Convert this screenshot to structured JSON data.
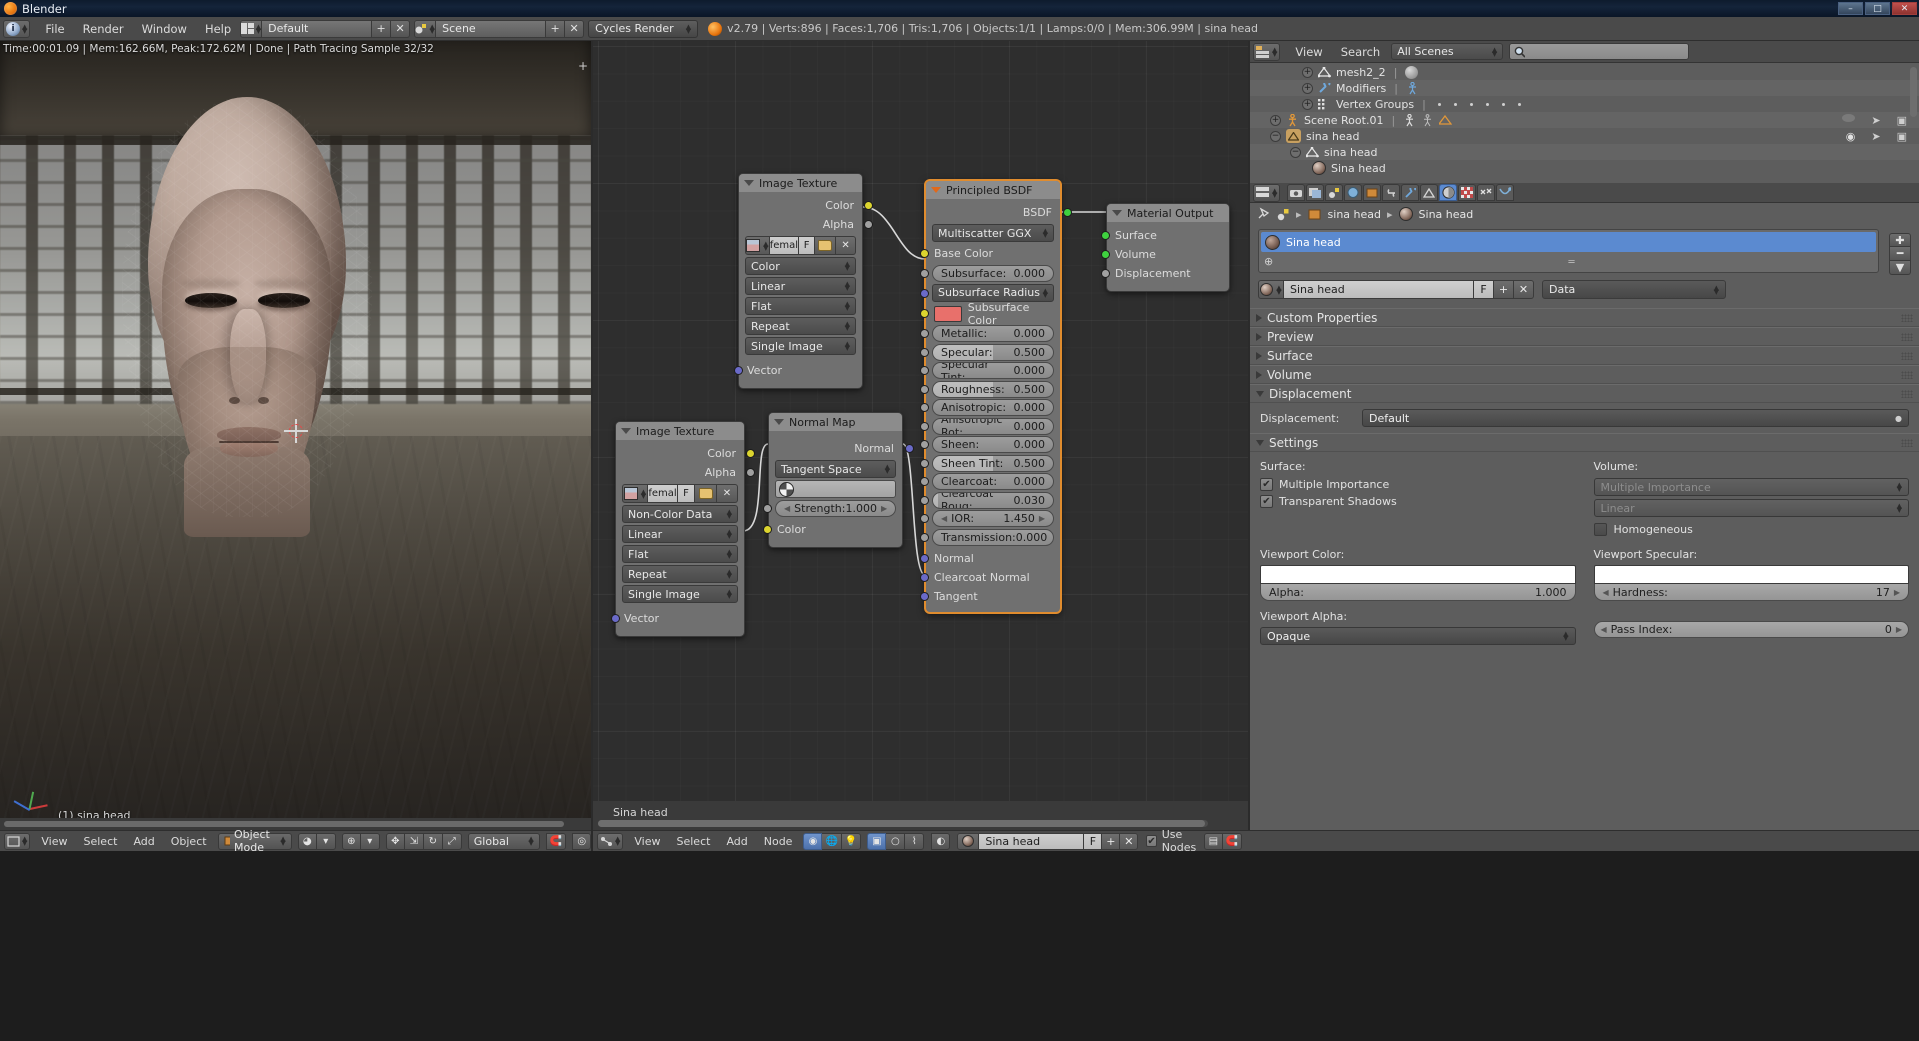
{
  "window": {
    "title": "Blender",
    "buttons": [
      "–",
      "□",
      "✕"
    ]
  },
  "header": {
    "screen_layout": "Default",
    "scene": "Scene",
    "engine": "Cycles Render",
    "menus": [
      "File",
      "Render",
      "Window",
      "Help"
    ],
    "stats": "v2.79 | Verts:896 | Faces:1,706 | Tris:1,706 | Objects:1/1 | Lamps:0/0 | Mem:306.99M | sina head",
    "add_icon": "+",
    "remove_icon": "✕"
  },
  "viewport": {
    "render_stats": "Time:00:01.09 | Mem:162.66M, Peak:172.62M | Done | Path Tracing Sample 32/32",
    "object_label": "(1) sina head",
    "bottom": {
      "menus": [
        "View",
        "Select",
        "Add",
        "Object"
      ],
      "mode": "Object Mode",
      "orientation": "Global",
      "pivot_icon": "pivot-icon",
      "snap_icon": "magnet-icon",
      "proportional_icon": "proportional-edit-icon",
      "layers_icon": "layers-icon"
    }
  },
  "node_editor": {
    "breadcrumb": "Sina head",
    "bottom": {
      "menus": [
        "View",
        "Select",
        "Add",
        "Node"
      ],
      "shader_type_icons": [
        "world-icon",
        "object-icon",
        "lamp-icon"
      ],
      "material_name": "Sina head",
      "fake_user": "F",
      "add_icon": "+",
      "remove_icon": "✕",
      "use_nodes_label": "Use Nodes",
      "use_nodes_checked": true
    },
    "nodes": [
      {
        "id": "image_texture_1",
        "title": "Image Texture",
        "outputs": [
          "Color",
          "Alpha"
        ],
        "image_name": "femal",
        "fake_user": "F",
        "dropdowns": [
          "Color",
          "Linear",
          "Flat",
          "Repeat",
          "Single Image"
        ],
        "inputs": [
          "Vector"
        ]
      },
      {
        "id": "principled_bsdf",
        "title": "Principled BSDF",
        "selected": true,
        "outputs": [
          "BSDF"
        ],
        "distribution": "Multiscatter GGX",
        "inputs": [
          {
            "label": "Base Color",
            "type": "socket",
            "socket": "yellow"
          },
          {
            "label": "Subsurface:",
            "value": "0.000",
            "type": "slider",
            "fill": 0.0
          },
          {
            "label": "Subsurface Radius",
            "type": "dropdown"
          },
          {
            "label": "Subsurface Color",
            "type": "color",
            "color": "#e8706b"
          },
          {
            "label": "Metallic:",
            "value": "0.000",
            "type": "slider",
            "fill": 0.0
          },
          {
            "label": "Specular:",
            "value": "0.500",
            "type": "slider",
            "fill": 0.5
          },
          {
            "label": "Specular Tint:",
            "value": "0.000",
            "type": "slider",
            "fill": 0.0
          },
          {
            "label": "Roughness:",
            "value": "0.500",
            "type": "slider",
            "fill": 0.5
          },
          {
            "label": "Anisotropic:",
            "value": "0.000",
            "type": "slider",
            "fill": 0.0
          },
          {
            "label": "Anisotropic Rot:",
            "value": "0.000",
            "type": "slider",
            "fill": 0.0
          },
          {
            "label": "Sheen:",
            "value": "0.000",
            "type": "slider",
            "fill": 0.0
          },
          {
            "label": "Sheen Tint:",
            "value": "0.500",
            "type": "slider",
            "fill": 0.5
          },
          {
            "label": "Clearcoat:",
            "value": "0.000",
            "type": "slider",
            "fill": 0.0
          },
          {
            "label": "Clearcoat Roug:",
            "value": "0.030",
            "type": "slider",
            "fill": 0.03
          },
          {
            "label": "IOR:",
            "value": "1.450",
            "type": "stepper"
          },
          {
            "label": "Transmission:",
            "value": "0.000",
            "type": "slider",
            "fill": 0.0
          },
          {
            "label": "Normal",
            "type": "socket",
            "socket": "blue"
          },
          {
            "label": "Clearcoat Normal",
            "type": "socket",
            "socket": "blue"
          },
          {
            "label": "Tangent",
            "type": "socket",
            "socket": "blue"
          }
        ]
      },
      {
        "id": "material_output",
        "title": "Material Output",
        "inputs": [
          "Surface",
          "Volume",
          "Displacement"
        ]
      },
      {
        "id": "image_texture_2",
        "title": "Image Texture",
        "outputs": [
          "Color",
          "Alpha"
        ],
        "image_name": "femal",
        "fake_user": "F",
        "dropdowns": [
          "Non-Color Data",
          "Linear",
          "Flat",
          "Repeat",
          "Single Image"
        ],
        "inputs": [
          "Vector"
        ]
      },
      {
        "id": "normal_map",
        "title": "Normal Map",
        "outputs": [
          "Normal"
        ],
        "space": "Tangent Space",
        "uv_map": "",
        "strength_label": "Strength:",
        "strength_value": "1.000",
        "inputs": [
          "Color"
        ]
      }
    ]
  },
  "outliner": {
    "view_label": "View",
    "search_label": "Search",
    "display_mode": "All Scenes",
    "search_placeholder": "",
    "rows": [
      {
        "label": "mesh2_2",
        "indent": 3,
        "icon": "mesh-icon",
        "expand": "+"
      },
      {
        "label": "Modifiers",
        "indent": 3,
        "icon": "wrench-icon",
        "expand": "+"
      },
      {
        "label": "Vertex Groups",
        "indent": 3,
        "icon": "vertexgroup-icon",
        "expand": "+"
      },
      {
        "label": "Scene Root.01",
        "indent": 1,
        "icon": "armature-icon",
        "expand": "+"
      },
      {
        "label": "sina head",
        "indent": 1,
        "icon": "mesh-object-icon",
        "expand": "−"
      },
      {
        "label": "sina head",
        "indent": 2,
        "icon": "mesh-data-icon",
        "expand": "−"
      },
      {
        "label": "Sina head",
        "indent": 3,
        "icon": "material-icon",
        "expand": ""
      }
    ]
  },
  "properties": {
    "tabs": [
      "render-icon",
      "render-layers-icon",
      "scene-icon",
      "world-icon",
      "object-icon",
      "constraints-icon",
      "modifiers-icon",
      "data-icon",
      "material-icon",
      "texture-icon",
      "particles-icon",
      "physics-icon"
    ],
    "active_tab_index": 8,
    "breadcrumb": [
      "sina head",
      "Sina head"
    ],
    "material_slot": "Sina head",
    "material_name": "Sina head",
    "fake_user": "F",
    "add_icon": "+",
    "remove_icon": "✕",
    "data_dropdown": "Data",
    "panels": [
      {
        "label": "Custom Properties",
        "open": false
      },
      {
        "label": "Preview",
        "open": false
      },
      {
        "label": "Surface",
        "open": false
      },
      {
        "label": "Volume",
        "open": false
      },
      {
        "label": "Displacement",
        "open": true
      },
      {
        "label": "Settings",
        "open": true
      }
    ],
    "displacement": {
      "label": "Displacement:",
      "value": "Default"
    },
    "settings": {
      "surface_label": "Surface:",
      "volume_label": "Volume:",
      "multiple_importance_label": "Multiple Importance",
      "multiple_importance_checked": true,
      "transparent_shadows_label": "Transparent Shadows",
      "transparent_shadows_checked": true,
      "volume_sampling": "Multiple Importance",
      "volume_interpolation": "Linear",
      "homogeneous_label": "Homogeneous",
      "homogeneous_checked": false,
      "viewport_color_label": "Viewport Color:",
      "viewport_color": "#ffffff",
      "alpha_label": "Alpha:",
      "alpha_value": "1.000",
      "viewport_alpha_label": "Viewport Alpha:",
      "viewport_alpha_value": "Opaque",
      "viewport_specular_label": "Viewport Specular:",
      "viewport_specular": "#ffffff",
      "hardness_label": "Hardness:",
      "hardness_value": "17",
      "pass_index_label": "Pass Index:",
      "pass_index_value": "0"
    }
  }
}
